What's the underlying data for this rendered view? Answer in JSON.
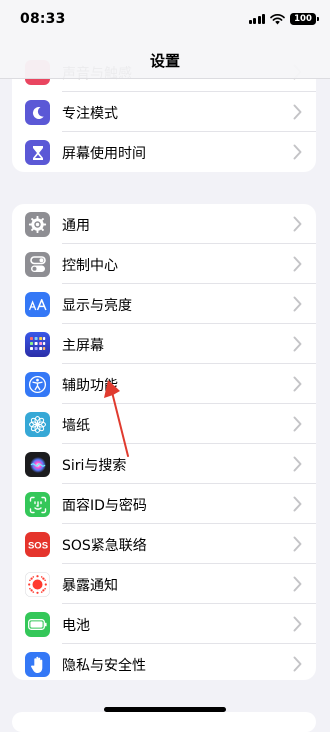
{
  "status_bar": {
    "time": "08:33",
    "battery": "100"
  },
  "nav": {
    "title": "设置"
  },
  "colors": {
    "accent": "#e03b2f",
    "background": "#f2f2f7"
  },
  "group_top": {
    "items": [
      {
        "label": "声音与触感",
        "icon": "sound-icon",
        "color": "#e94560"
      },
      {
        "label": "专注模式",
        "icon": "moon-icon",
        "color": "#5b58d6"
      },
      {
        "label": "屏幕使用时间",
        "icon": "hourglass-icon",
        "color": "#5b58d6"
      }
    ]
  },
  "group_main": {
    "items": [
      {
        "label": "通用",
        "icon": "gear-icon",
        "color": "#8e8e93"
      },
      {
        "label": "控制中心",
        "icon": "toggle-icon",
        "color": "#8e8e93"
      },
      {
        "label": "显示与亮度",
        "icon": "text-size-icon",
        "color": "#3478f6"
      },
      {
        "label": "主屏幕",
        "icon": "home-grid-icon",
        "color": "#2f3fb8"
      },
      {
        "label": "辅助功能",
        "icon": "accessibility-icon",
        "color": "#3478f6"
      },
      {
        "label": "墙纸",
        "icon": "wallpaper-flower-icon",
        "color": "#36a8d6"
      },
      {
        "label": "Siri与搜索",
        "icon": "siri-icon",
        "color": "#1c1c1e"
      },
      {
        "label": "面容ID与密码",
        "icon": "face-id-icon",
        "color": "#34c759"
      },
      {
        "label": "SOS紧急联络",
        "icon": "sos-icon",
        "color": "#e5342c"
      },
      {
        "label": "暴露通知",
        "icon": "exposure-icon",
        "color": "#ffffff"
      },
      {
        "label": "电池",
        "icon": "battery-icon",
        "color": "#34c759"
      },
      {
        "label": "隐私与安全性",
        "icon": "hand-icon",
        "color": "#3478f6"
      }
    ]
  }
}
